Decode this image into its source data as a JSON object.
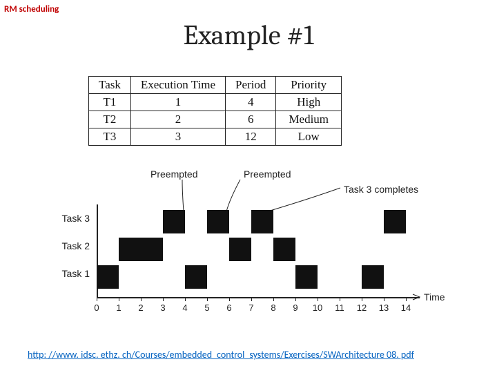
{
  "section_label": "RM scheduling",
  "title": "Example #1",
  "table": {
    "headers": [
      "Task",
      "Execution Time",
      "Period",
      "Priority"
    ],
    "rows": [
      [
        "T1",
        "1",
        "4",
        "High"
      ],
      [
        "T2",
        "2",
        "6",
        "Medium"
      ],
      [
        "T3",
        "3",
        "12",
        "Low"
      ]
    ]
  },
  "chart_data": {
    "type": "bar",
    "row_labels": [
      "Task 3",
      "Task 2",
      "Task 1"
    ],
    "x_ticks": [
      "0",
      "1",
      "2",
      "3",
      "4",
      "5",
      "6",
      "7",
      "8",
      "9",
      "10",
      "11",
      "12",
      "13",
      "14"
    ],
    "x_axis_label": "Time",
    "series": [
      {
        "name": "Task 3",
        "intervals": [
          [
            3,
            4
          ],
          [
            5,
            6
          ],
          [
            7,
            8
          ],
          [
            13,
            14
          ]
        ]
      },
      {
        "name": "Task 2",
        "intervals": [
          [
            1,
            3
          ],
          [
            6,
            7
          ],
          [
            8,
            9
          ]
        ]
      },
      {
        "name": "Task 1",
        "intervals": [
          [
            0,
            1
          ],
          [
            4,
            5
          ],
          [
            9,
            10
          ],
          [
            12,
            13
          ]
        ]
      }
    ],
    "annotations": {
      "preempted1": "Preempted",
      "preempted2": "Preempted",
      "completes": "Task 3 completes"
    },
    "xlim": [
      0,
      14
    ]
  },
  "footer_url": "http: //www. idsc. ethz. ch/Courses/embedded_control_systems/Exercises/SWArchitecture 08. pdf"
}
